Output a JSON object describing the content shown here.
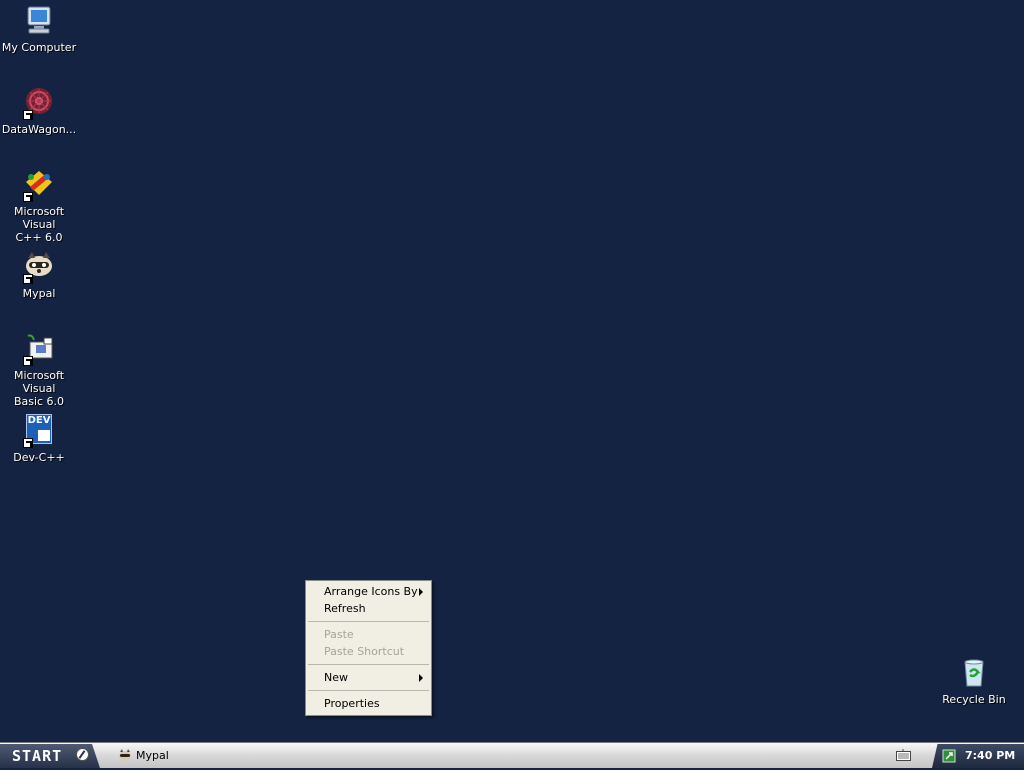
{
  "desktop": {
    "icons": [
      {
        "label": "My Computer"
      },
      {
        "label": "DataWagon..."
      },
      {
        "label_line1": "Microsoft Visual",
        "label_line2": "C++ 6.0"
      },
      {
        "label": "Mypal"
      },
      {
        "label_line1": "Microsoft Visual",
        "label_line2": "Basic 6.0"
      },
      {
        "label": "Dev-C++",
        "badge": "DEV"
      },
      {
        "label": "Recycle Bin"
      }
    ],
    "background_color": "#142341"
  },
  "context_menu": {
    "items": [
      {
        "label": "Arrange Icons By",
        "submenu": true,
        "enabled": true
      },
      {
        "label": "Refresh",
        "enabled": true
      },
      {
        "label": "Paste",
        "enabled": false
      },
      {
        "label": "Paste Shortcut",
        "enabled": false
      },
      {
        "label": "New",
        "submenu": true,
        "enabled": true
      },
      {
        "label": "Properties",
        "enabled": true
      }
    ]
  },
  "taskbar": {
    "start_label": "START",
    "tasks": [
      {
        "label": "Mypal",
        "icon": "raccoon-icon"
      }
    ],
    "clock": "7:40 PM",
    "tray_icons": [
      "keyboard-icon",
      "network-icon"
    ]
  }
}
